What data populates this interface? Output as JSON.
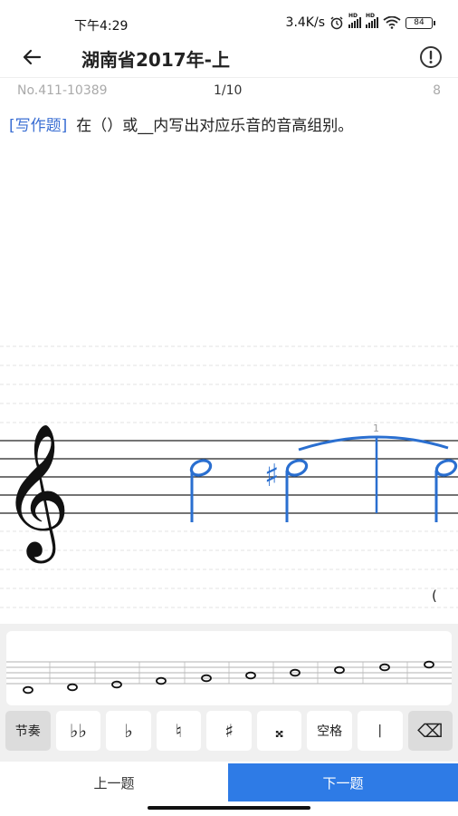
{
  "status": {
    "time": "下午4:29",
    "network_speed": "3.4K/s",
    "battery": "84",
    "icons": [
      "alarm-icon",
      "signal-icon",
      "signal-icon",
      "wifi-icon",
      "battery-icon"
    ]
  },
  "header": {
    "title": "湖南省2017年-上",
    "back_icon": "arrow-left-icon",
    "info_icon": "exclamation-circle-icon"
  },
  "meta": {
    "question_no": "No.411-10389",
    "page": "1/10",
    "score": "8"
  },
  "question": {
    "tag": "[写作题]",
    "text": "在（）或__内写出对应乐音的音高组别。"
  },
  "staff": {
    "clef": "treble-clef",
    "measure_number": "1",
    "accidental": "♯",
    "open_paren": "("
  },
  "keyboard": {
    "keys": [
      {
        "label": "节奏",
        "style": "gray"
      },
      {
        "label": "♭♭",
        "style": "white"
      },
      {
        "label": "♭",
        "style": "white"
      },
      {
        "label": "♮",
        "style": "white"
      },
      {
        "label": "♯",
        "style": "white"
      },
      {
        "label": "𝄪",
        "style": "white"
      },
      {
        "label": "空格",
        "style": "white"
      },
      {
        "label": "|",
        "style": "white"
      },
      {
        "label": "⌫",
        "style": "gray"
      }
    ]
  },
  "nav": {
    "prev_label": "上一题",
    "next_label": "下一题"
  },
  "colors": {
    "accent": "#2e7be6",
    "note_blue": "#2a6fd0",
    "tag_blue": "#3b6fd3"
  }
}
